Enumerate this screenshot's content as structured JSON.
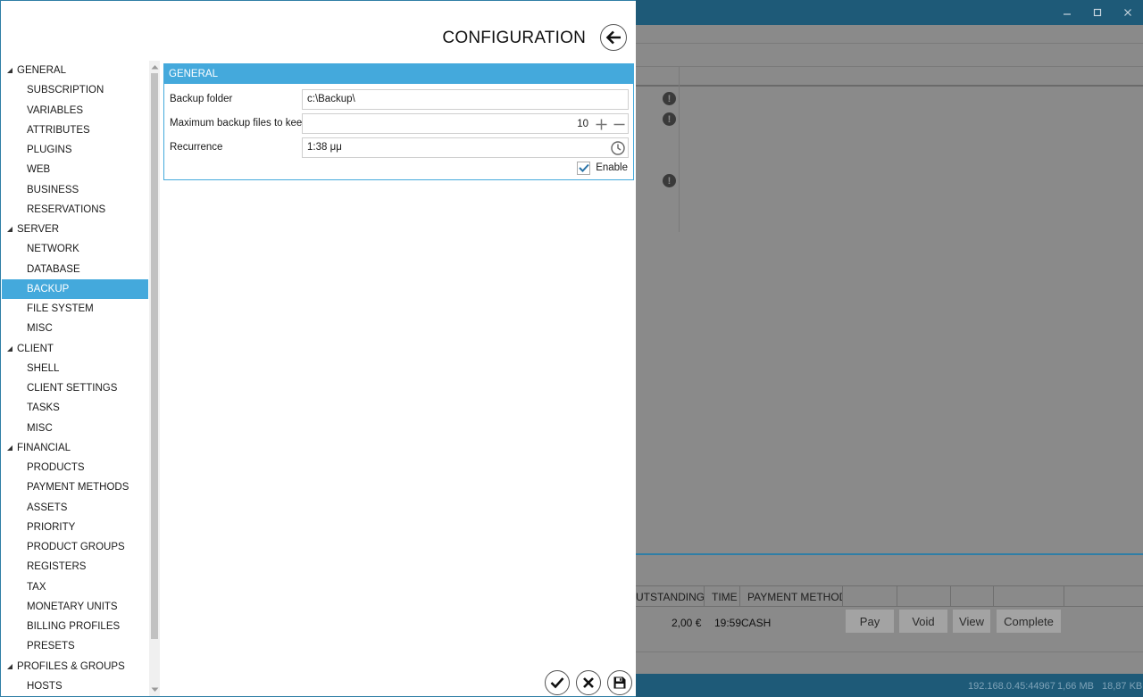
{
  "background": {
    "window_controls": [
      "minimize-icon",
      "maximize-icon",
      "close-icon"
    ],
    "table": {
      "columns": [
        "UTSTANDING",
        "TIME",
        "PAYMENT METHOD",
        "",
        "",
        "",
        "",
        ""
      ],
      "row": {
        "outstanding": "2,00 €",
        "time": "19:59",
        "payment_method": "CASH",
        "actions": [
          "Pay",
          "Void",
          "View",
          "Complete"
        ]
      }
    },
    "status_bar": {
      "address": "192.168.0.45:44967",
      "received": "1,66 MB",
      "sent": "18,87 KB"
    }
  },
  "config": {
    "title": "CONFIGURATION",
    "nav": [
      {
        "label": "GENERAL",
        "type": "group"
      },
      {
        "label": "SUBSCRIPTION",
        "type": "child"
      },
      {
        "label": "VARIABLES",
        "type": "child"
      },
      {
        "label": "ATTRIBUTES",
        "type": "child"
      },
      {
        "label": "PLUGINS",
        "type": "child"
      },
      {
        "label": "WEB",
        "type": "child"
      },
      {
        "label": "BUSINESS",
        "type": "child"
      },
      {
        "label": "RESERVATIONS",
        "type": "child"
      },
      {
        "label": "SERVER",
        "type": "group"
      },
      {
        "label": "NETWORK",
        "type": "child"
      },
      {
        "label": "DATABASE",
        "type": "child"
      },
      {
        "label": "BACKUP",
        "type": "child",
        "selected": true
      },
      {
        "label": "FILE SYSTEM",
        "type": "child"
      },
      {
        "label": "MISC",
        "type": "child"
      },
      {
        "label": "CLIENT",
        "type": "group"
      },
      {
        "label": "SHELL",
        "type": "child"
      },
      {
        "label": "CLIENT SETTINGS",
        "type": "child"
      },
      {
        "label": "TASKS",
        "type": "child"
      },
      {
        "label": "MISC",
        "type": "child"
      },
      {
        "label": "FINANCIAL",
        "type": "group"
      },
      {
        "label": "PRODUCTS",
        "type": "child"
      },
      {
        "label": "PAYMENT METHODS",
        "type": "child"
      },
      {
        "label": "ASSETS",
        "type": "child"
      },
      {
        "label": "PRIORITY",
        "type": "child"
      },
      {
        "label": "PRODUCT GROUPS",
        "type": "child"
      },
      {
        "label": "REGISTERS",
        "type": "child"
      },
      {
        "label": "TAX",
        "type": "child"
      },
      {
        "label": "MONETARY UNITS",
        "type": "child"
      },
      {
        "label": "BILLING PROFILES",
        "type": "child"
      },
      {
        "label": "PRESETS",
        "type": "child"
      },
      {
        "label": "PROFILES & GROUPS",
        "type": "group"
      },
      {
        "label": "HOSTS",
        "type": "child"
      }
    ],
    "section": {
      "header": "GENERAL",
      "backup_folder": {
        "label": "Backup folder",
        "value": "c:\\Backup\\"
      },
      "max_files": {
        "label": "Maximum backup files to keep",
        "value": "10"
      },
      "recurrence": {
        "label": "Recurrence",
        "value": "1:38 μμ"
      },
      "enable": {
        "label": "Enable",
        "checked": true
      }
    },
    "colors": {
      "accent": "#44a9dc",
      "titlebar": "#1e5a78"
    }
  }
}
